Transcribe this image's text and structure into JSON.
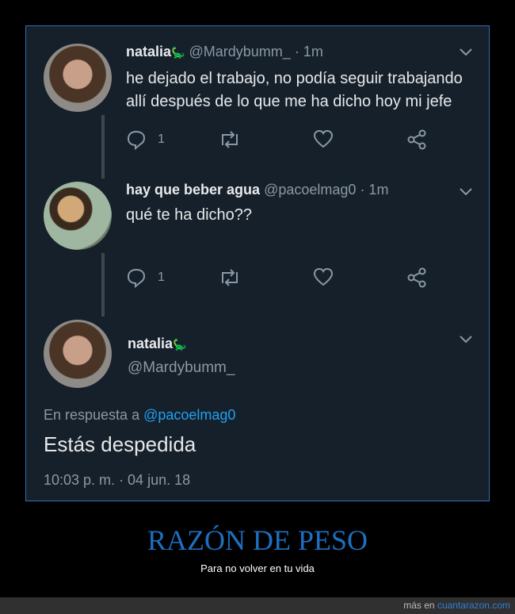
{
  "tweets": [
    {
      "name": "natalia",
      "emoji": "🦕",
      "handle": "@Mardybumm_",
      "time": "· 1m",
      "text_lines": [
        "he dejado el trabajo, no podía seguir trabajando",
        "allí después de lo que me ha dicho hoy mi jefe"
      ],
      "reply_count": "1"
    },
    {
      "name": "hay que beber agua",
      "handle": "@pacoelmag0",
      "time": "· 1m",
      "text_lines": [
        "qué te ha dicho??"
      ],
      "reply_count": "1"
    }
  ],
  "main_tweet": {
    "name": "natalia",
    "emoji": "🦕",
    "handle": "@Mardybumm_",
    "reply_prefix": "En respuesta a",
    "reply_to": "@pacoelmag0",
    "text": "Estás despedida",
    "timestamp": "10:03 p. m. · 04 jun. 18"
  },
  "caption": {
    "title": "RAZÓN DE PESO",
    "subtitle": "Para no volver en tu  vida"
  },
  "footer": {
    "prefix": "más en",
    "site": "cuantarazon.com"
  },
  "icons": [
    "reply-icon",
    "retweet-icon",
    "like-icon",
    "share-icon",
    "chevron-down-icon"
  ],
  "colors": {
    "background": "#16202b",
    "link": "#1da1f2",
    "caption": "#1d6fc0",
    "muted": "#8899a6"
  }
}
